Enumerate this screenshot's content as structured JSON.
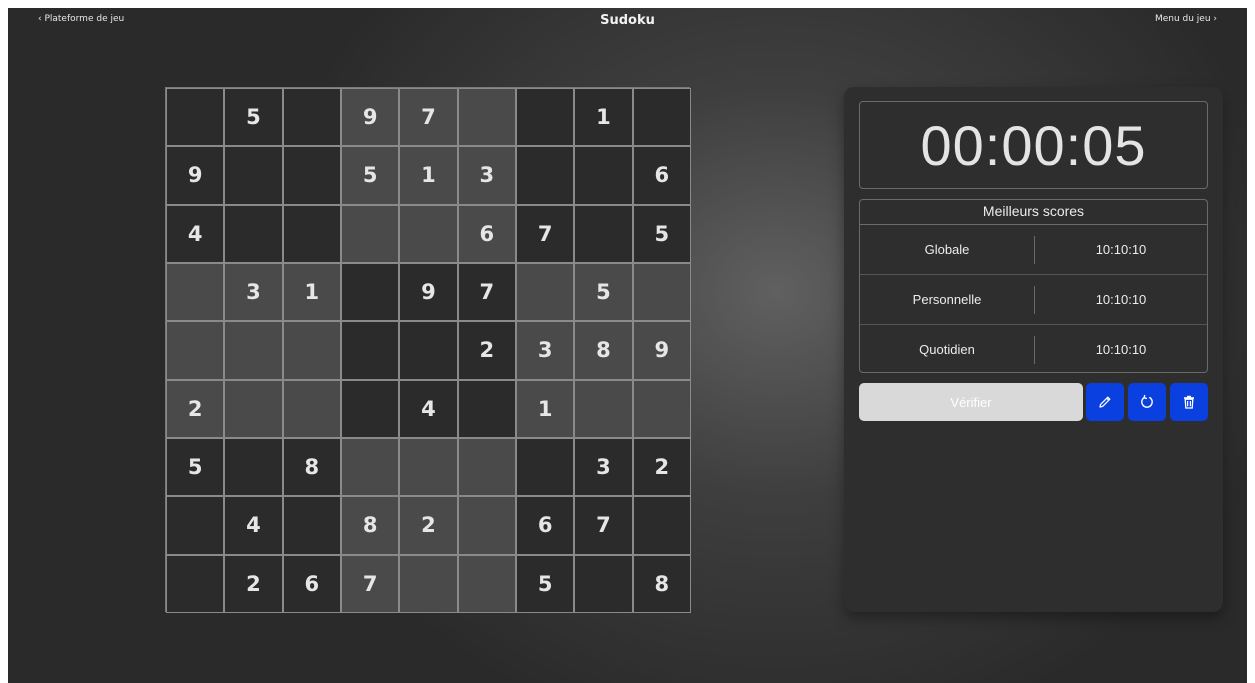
{
  "nav": {
    "left_label": "‹ Plateforme de jeu",
    "title": "Sudoku",
    "right_label": "Menu du jeu ›"
  },
  "board": {
    "cells": [
      [
        "",
        "5",
        "",
        "9",
        "7",
        "",
        "",
        "1",
        ""
      ],
      [
        "9",
        "",
        "",
        "5",
        "1",
        "3",
        "",
        "",
        "6"
      ],
      [
        "4",
        "",
        "",
        "",
        "",
        "6",
        "7",
        "",
        "5"
      ],
      [
        "",
        "3",
        "1",
        "",
        "9",
        "7",
        "",
        "5",
        ""
      ],
      [
        "",
        "",
        "",
        "",
        "",
        "2",
        "3",
        "8",
        "9"
      ],
      [
        "2",
        "",
        "",
        "",
        "4",
        "",
        "1",
        "",
        ""
      ],
      [
        "5",
        "",
        "8",
        "",
        "",
        "",
        "",
        "3",
        "2"
      ],
      [
        "",
        "4",
        "",
        "8",
        "2",
        "",
        "6",
        "7",
        ""
      ],
      [
        "",
        "2",
        "6",
        "7",
        "",
        "",
        "5",
        "",
        "8"
      ]
    ]
  },
  "timer": {
    "value": "00:00:05"
  },
  "scores": {
    "title": "Meilleurs scores",
    "rows": [
      {
        "label": "Globale",
        "value": "10:10:10"
      },
      {
        "label": "Personnelle",
        "value": "10:10:10"
      },
      {
        "label": "Quotidien",
        "value": "10:10:10"
      }
    ]
  },
  "actions": {
    "verify_label": "Vérifier",
    "edit_icon": "pencil-icon",
    "reset_icon": "refresh-icon",
    "delete_icon": "trash-icon"
  },
  "colors": {
    "accent": "#0a3fe0",
    "verify_bg": "#d9d9d9"
  }
}
